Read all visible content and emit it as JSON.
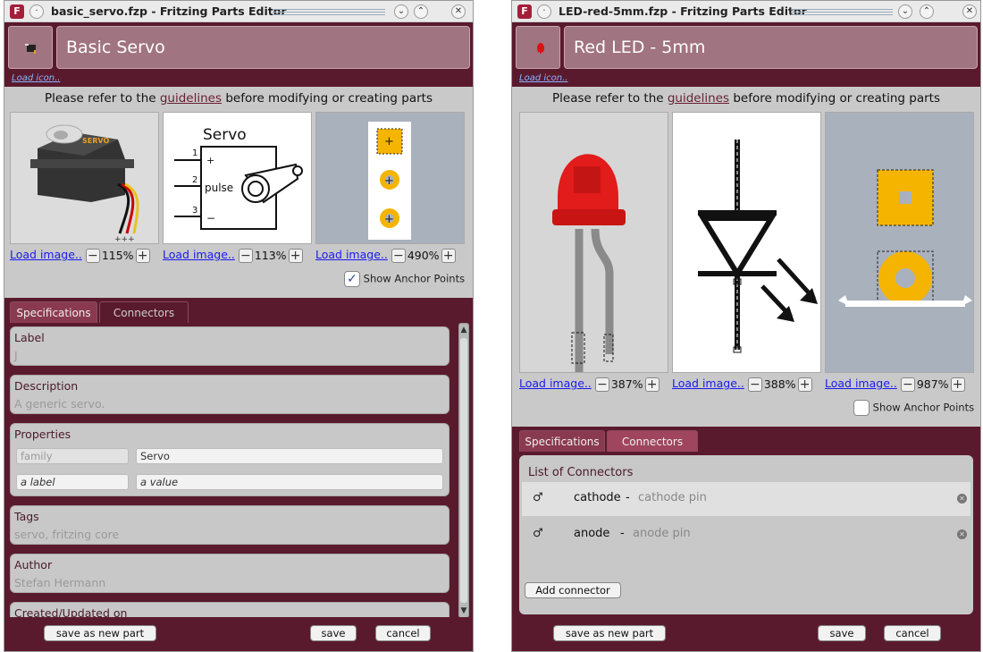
{
  "windows": [
    {
      "title": "basic_servo.fzp - Fritzing Parts Editor",
      "part_title": "Basic Servo",
      "load_icon": "Load icon..",
      "guidelines_prefix": "Please refer to the",
      "guidelines_link": "guidelines",
      "guidelines_suffix": "before modifying or creating parts",
      "views": [
        {
          "load": "Load image..",
          "zoom": "115%"
        },
        {
          "load": "Load image..",
          "zoom": "113%"
        },
        {
          "load": "Load image..",
          "zoom": "490%"
        }
      ],
      "schematic_title": "Servo",
      "schematic_pins": [
        "1",
        "2",
        "3"
      ],
      "schematic_pin_labels": [
        "+",
        "pulse",
        "−"
      ],
      "servo_brand": "SERVO",
      "show_anchor": "Show Anchor Points",
      "show_anchor_checked": true,
      "tabs": [
        "Specifications",
        "Connectors"
      ],
      "active_tab": 0,
      "fields": {
        "label": {
          "name": "Label",
          "value": "J"
        },
        "description": {
          "name": "Description",
          "value": "A generic servo."
        },
        "properties": {
          "name": "Properties",
          "rows": [
            [
              "family",
              "Servo"
            ],
            [
              "a label",
              "a value"
            ]
          ]
        },
        "tags": {
          "name": "Tags",
          "value": "servo, fritzing core"
        },
        "author": {
          "name": "Author",
          "value": "Stefan Hermann"
        },
        "created": {
          "name": "Created/Updated on"
        }
      },
      "buttons": {
        "save_new": "save as new part",
        "save": "save",
        "cancel": "cancel"
      }
    },
    {
      "title": "LED-red-5mm.fzp - Fritzing Parts Editor",
      "part_title": "Red LED - 5mm",
      "load_icon": "Load icon..",
      "guidelines_prefix": "Please refer to the",
      "guidelines_link": "guidelines",
      "guidelines_suffix": "before modifying or creating parts",
      "views": [
        {
          "load": "Load image..",
          "zoom": "387%"
        },
        {
          "load": "Load image..",
          "zoom": "388%"
        },
        {
          "load": "Load image..",
          "zoom": "987%"
        }
      ],
      "show_anchor": "Show Anchor Points",
      "show_anchor_checked": false,
      "tabs": [
        "Specifications",
        "Connectors"
      ],
      "active_tab": 1,
      "connectors_title": "List of Connectors",
      "connectors": [
        {
          "name": "cathode",
          "sep": "-",
          "desc": "cathode pin",
          "gender": "♂"
        },
        {
          "name": "anode",
          "sep": "-",
          "desc": "anode pin",
          "gender": "♂"
        }
      ],
      "add_connector": "Add connector",
      "buttons": {
        "save_new": "save as new part",
        "save": "save",
        "cancel": "cancel"
      }
    }
  ]
}
